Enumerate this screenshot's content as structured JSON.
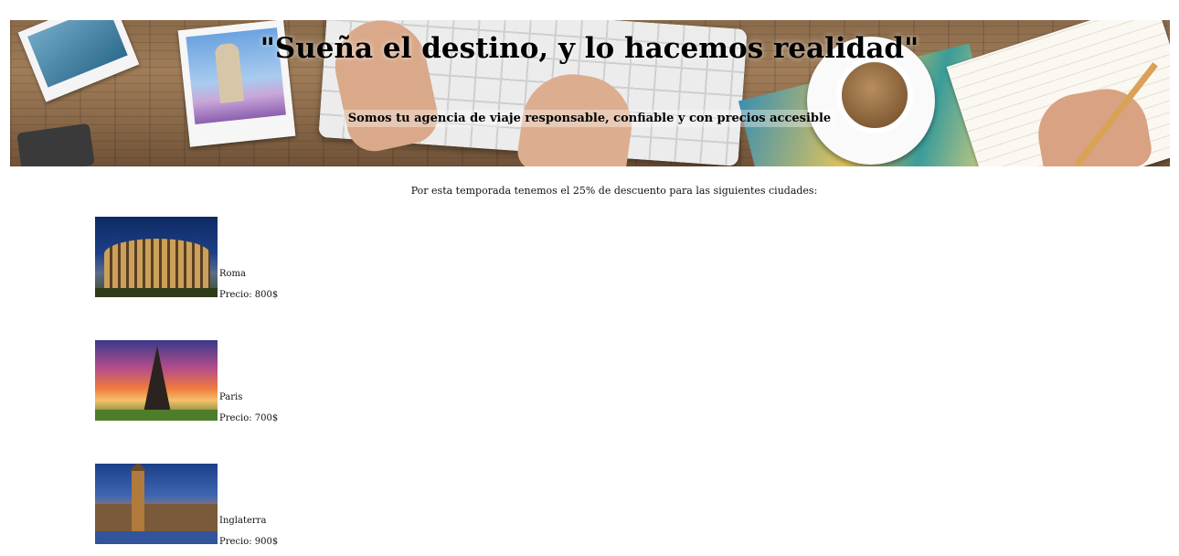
{
  "banner": {
    "headline": "\"Sueña el destino, y lo hacemos realidad\"",
    "subline": "Somos tu agencia de viaje responsable, confiable y con precios accesible"
  },
  "intro": "Por esta temporada tenemos el 25% de descuento para las siguientes ciudades:",
  "cities": [
    {
      "name": "Roma",
      "price": "Precio: 800$"
    },
    {
      "name": "Paris",
      "price": "Precio: 700$"
    },
    {
      "name": "Inglaterra",
      "price": "Precio: 900$"
    }
  ]
}
